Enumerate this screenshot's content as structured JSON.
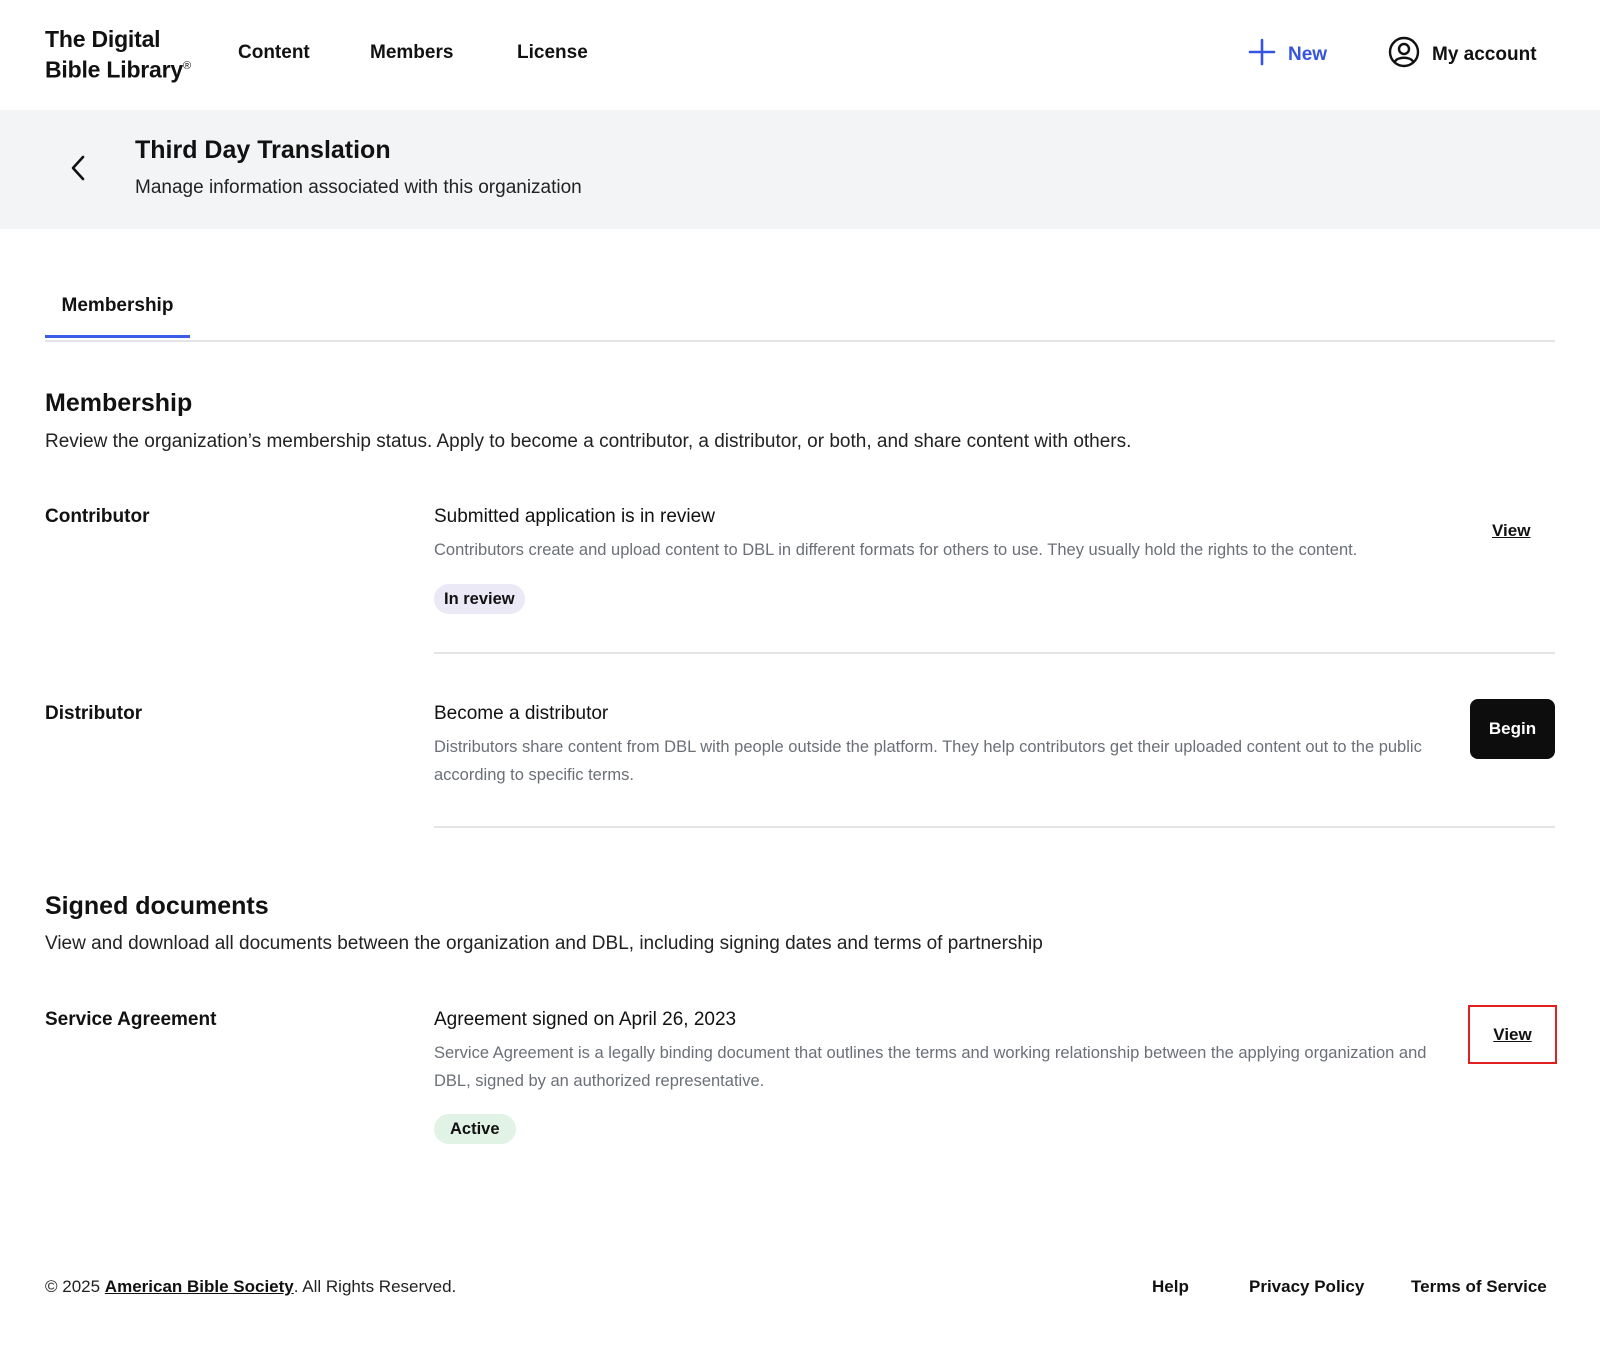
{
  "brand": {
    "line1": "The Digital",
    "line2": "Bible Library",
    "reg": "®"
  },
  "nav": {
    "content": "Content",
    "members": "Members",
    "license": "License"
  },
  "actions": {
    "new_label": "New",
    "account_label": "My account"
  },
  "header": {
    "title": "Third Day Translation",
    "subtitle": "Manage information associated with this organization"
  },
  "tabs": [
    {
      "label": "Membership",
      "active": true
    }
  ],
  "membership": {
    "title": "Membership",
    "description": "Review the organization’s membership status. Apply to become a contributor, a distributor, or both, and share content with others.",
    "contributor": {
      "label": "Contributor",
      "status_title": "Submitted application is in review",
      "description": "Contributors create and upload content to DBL in different formats for others to use. They usually hold the rights to the content.",
      "badge": "In review",
      "action": "View"
    },
    "distributor": {
      "label": "Distributor",
      "status_title": "Become a distributor",
      "description": "Distributors share content from DBL with people outside the platform. They help contributors get their uploaded content out to the public according to specific terms.",
      "action": "Begin"
    }
  },
  "signed_documents": {
    "title": "Signed documents",
    "description": "View and download all documents between the organization and DBL, including signing dates and terms of partnership",
    "service_agreement": {
      "label": "Service Agreement",
      "status_title": "Agreement signed on April 26, 2023",
      "description": "Service Agreement is a legally binding document that outlines the terms and working relationship between the applying organization and DBL, signed by an authorized representative.",
      "badge": "Active",
      "action": "View"
    }
  },
  "footer": {
    "copyright_prefix": "© 2025 ",
    "org_link": "American Bible Society",
    "copyright_suffix": ". All Rights Reserved.",
    "help": "Help",
    "privacy": "Privacy Policy",
    "terms": "Terms of Service"
  },
  "colors": {
    "accent": "#3a5ce6",
    "highlight": "#e02020",
    "badge_review": "#ece9f7",
    "badge_active": "#e1f3e5"
  }
}
